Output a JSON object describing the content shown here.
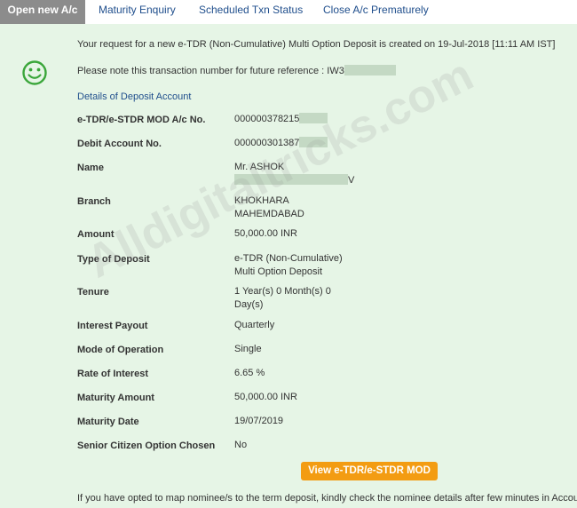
{
  "tabs": [
    {
      "label": "Open new A/c"
    },
    {
      "label": "Maturity Enquiry"
    },
    {
      "label": "Scheduled Txn Status"
    },
    {
      "label": "Close A/c Prematurely"
    }
  ],
  "confirmation": {
    "message": "Your request for a new e-TDR (Non-Cumulative) Multi Option Deposit is created on 19-Jul-2018 [11:11 AM IST]",
    "reference_text": "Please note this transaction number for future reference : IW3"
  },
  "section_title": "Details of Deposit Account",
  "details": {
    "account_no": {
      "label": "e-TDR/e-STDR MOD A/c No.",
      "value": "000000378215"
    },
    "debit_account": {
      "label": "Debit Account No.",
      "value": "000000301387"
    },
    "name": {
      "label": "Name",
      "line1": "Mr. ASHOK",
      "line2": "V"
    },
    "branch": {
      "label": "Branch",
      "line1": "KHOKHARA",
      "line2": "MAHEMDABAD"
    },
    "amount": {
      "label": "Amount",
      "value": "50,000.00 INR"
    },
    "deposit_type": {
      "label": "Type of Deposit",
      "line1": "e-TDR (Non-Cumulative)",
      "line2": "Multi Option Deposit"
    },
    "tenure": {
      "label": "Tenure",
      "line1": "1 Year(s) 0 Month(s) 0",
      "line2": "Day(s)"
    },
    "interest_payout": {
      "label": "Interest Payout",
      "value": "Quarterly"
    },
    "mode": {
      "label": "Mode of Operation",
      "value": "Single"
    },
    "rate": {
      "label": "Rate of Interest",
      "value": "6.65  %"
    },
    "maturity_amount": {
      "label": "Maturity Amount",
      "value": "50,000.00  INR"
    },
    "maturity_date": {
      "label": "Maturity Date",
      "value": "19/07/2019"
    },
    "senior_citizen": {
      "label": "Senior Citizen Option Chosen",
      "value": "No"
    }
  },
  "view_button": "View e-TDR/e-STDR MOD",
  "nominee_note": "If you have opted to map nominee/s to the term deposit, kindly check the nominee details after few minutes in Accounts",
  "watermark": "Alldigitaltricks.com",
  "colors": {
    "panel_bg": "#e6f5e6",
    "active_tab": "#8c8c8c",
    "link": "#1f4e8c",
    "button": "#f39c12",
    "smiley": "#3aa63a"
  }
}
